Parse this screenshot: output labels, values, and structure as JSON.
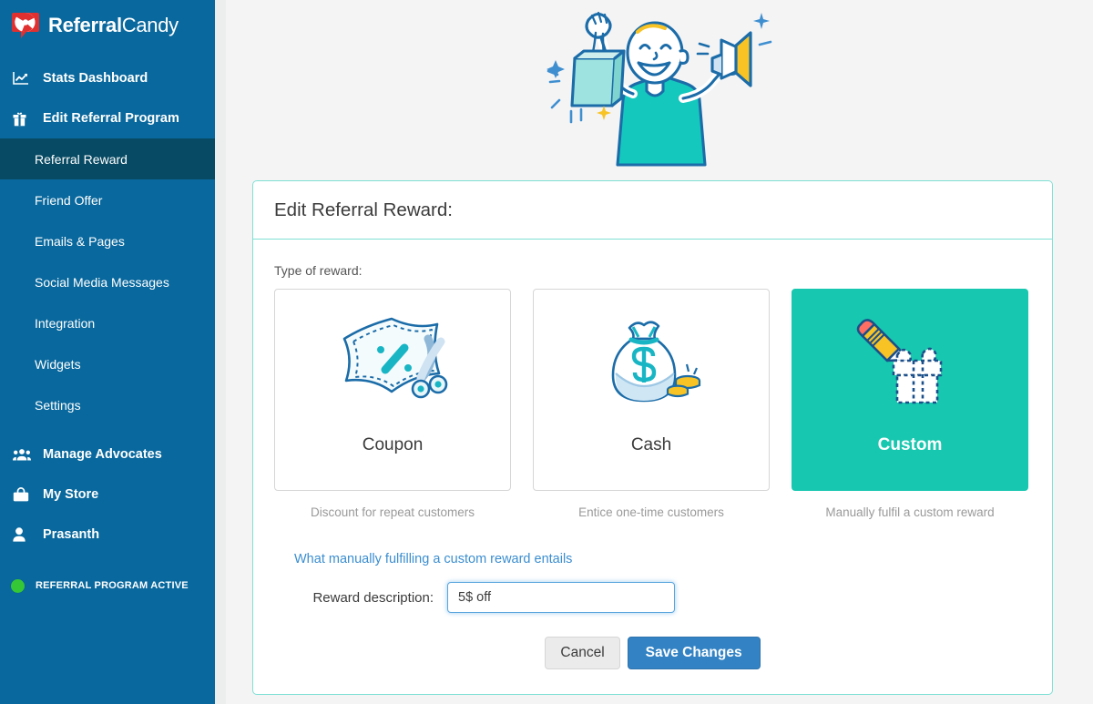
{
  "brand": {
    "name_bold": "Referral",
    "name_light": "Candy",
    "logo_icon": "candy-pinwheel-speech-bubble-icon",
    "sidebar_color": "#09689d",
    "sidebar_active_color": "#074a63",
    "accent_teal": "#17c7af",
    "panel_border": "#7fe0d4",
    "primary_button": "#3383c4",
    "link_color": "#3b8ed0"
  },
  "sidebar": {
    "items": [
      {
        "label": "Stats Dashboard",
        "icon": "chart-line-icon",
        "type": "top",
        "active": false
      },
      {
        "label": "Edit Referral Program",
        "icon": "gift-icon",
        "type": "top",
        "active": false
      }
    ],
    "sub_items": [
      {
        "label": "Referral Reward",
        "active": true
      },
      {
        "label": "Friend Offer",
        "active": false
      },
      {
        "label": "Emails & Pages",
        "active": false
      },
      {
        "label": "Social Media Messages",
        "active": false
      },
      {
        "label": "Integration",
        "active": false
      },
      {
        "label": "Widgets",
        "active": false
      },
      {
        "label": "Settings",
        "active": false
      }
    ],
    "bottom_items": [
      {
        "label": "Manage Advocates",
        "icon": "users-group-icon"
      },
      {
        "label": "My Store",
        "icon": "store-bag-icon"
      },
      {
        "label": "Prasanth",
        "icon": "user-icon"
      }
    ],
    "status": {
      "label": "REFERRAL PROGRAM ACTIVE",
      "dot_icon": "status-dot-icon",
      "dot_color": "#35c735"
    }
  },
  "hero": {
    "illustration": "man-holding-shopping-bag-and-megaphone-illustration"
  },
  "panel": {
    "title": "Edit Referral Reward:",
    "type_label": "Type of reward:",
    "reward_types": [
      {
        "name": "Coupon",
        "caption": "Discount for repeat customers",
        "icon": "coupon-scissors-icon",
        "selected": false
      },
      {
        "name": "Cash",
        "caption": "Entice one-time customers",
        "icon": "money-bag-coins-icon",
        "selected": false
      },
      {
        "name": "Custom",
        "caption": "Manually fulfil a custom reward",
        "icon": "pencil-gift-box-icon",
        "selected": true
      }
    ],
    "help_link": "What manually fulfilling a custom reward entails",
    "reward_description": {
      "label": "Reward description:",
      "value": "5$ off",
      "placeholder": ""
    },
    "buttons": {
      "cancel": "Cancel",
      "save": "Save Changes"
    }
  }
}
